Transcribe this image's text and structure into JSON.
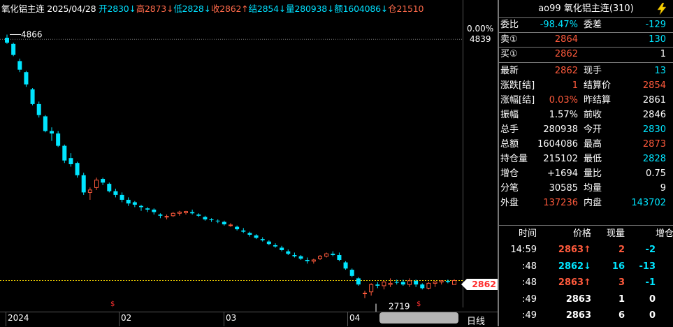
{
  "header": {
    "name": "氧化铝主连",
    "date": "2025/04/28",
    "open_label": "开",
    "open": "2830",
    "high_label": "高",
    "high": "2873",
    "low_label": "低",
    "low": "2828",
    "close_label": "收",
    "close": "2862",
    "settle_label": "结",
    "settle": "2854",
    "vol_label": "量",
    "vol": "280938",
    "amt_label": "额",
    "amt": "1604086",
    "oi_label": "仓",
    "oi": "21510"
  },
  "price_axis": {
    "pct": "0.00%",
    "top_price": "4839",
    "high_marker": "4866",
    "low_marker": "2719",
    "last_price_tag": "2862"
  },
  "x_axis": {
    "labels": [
      "2024",
      "02",
      "03",
      "04"
    ],
    "period_label": "日线"
  },
  "colors": {
    "up": "#ff5a3c",
    "down": "#00e5ff",
    "yellow": "#f0d000",
    "background": "#000000"
  },
  "panel": {
    "title": "ao99 氧化铝主连(310)",
    "bolt_icon": "lightning-bolt-icon",
    "weibi_label": "委比",
    "weibi": "-98.47%",
    "weicha_label": "委差",
    "weicha": "-129",
    "sell1_label": "卖①",
    "sell1_price": "2864",
    "sell1_vol": "130",
    "buy1_label": "买①",
    "buy1_price": "2862",
    "buy1_vol": "1",
    "stats": [
      {
        "l1": "最新",
        "v1": "2862",
        "c1": "#ff5a3c",
        "l2": "现手",
        "v2": "13",
        "c2": "#00e5ff"
      },
      {
        "l1": "涨跌[结]",
        "v1": "1",
        "c1": "#ff5a3c",
        "l2": "结算价",
        "v2": "2854",
        "c2": "#ff5a3c"
      },
      {
        "l1": "涨幅[结]",
        "v1": "0.03%",
        "c1": "#ff5a3c",
        "l2": "昨结算",
        "v2": "2861",
        "c2": "#ffffff"
      },
      {
        "l1": "振幅",
        "v1": "1.57%",
        "c1": "#ffffff",
        "l2": "前收",
        "v2": "2846",
        "c2": "#ffffff"
      },
      {
        "l1": "总手",
        "v1": "280938",
        "c1": "#ffffff",
        "l2": "今开",
        "v2": "2830",
        "c2": "#00e5ff"
      },
      {
        "l1": "总额",
        "v1": "1604086",
        "c1": "#ffffff",
        "l2": "最高",
        "v2": "2873",
        "c2": "#ff5a3c"
      },
      {
        "l1": "持仓量",
        "v1": "215102",
        "c1": "#ffffff",
        "l2": "最低",
        "v2": "2828",
        "c2": "#00e5ff"
      },
      {
        "l1": "增仓",
        "v1": "+1694",
        "c1": "#ffffff",
        "l2": "量比",
        "v2": "0.75",
        "c2": "#ffffff"
      },
      {
        "l1": "分笔",
        "v1": "30585",
        "c1": "#ffffff",
        "l2": "均量",
        "v2": "9",
        "c2": "#ffffff"
      },
      {
        "l1": "外盘",
        "v1": "137236",
        "c1": "#ff5a3c",
        "l2": "内盘",
        "v2": "143702",
        "c2": "#00e5ff"
      }
    ],
    "ticks_header": {
      "time": "时间",
      "price": "价格",
      "vol": "现量",
      "oi": "增仓"
    },
    "ticks": [
      {
        "time": "14:59",
        "price": "2863",
        "arrow": "↑",
        "pcolor": "#ff5a3c",
        "vol": "2",
        "vcolor": "#ff5a3c",
        "oi": "-2",
        "ocolor": "#00e5ff"
      },
      {
        "time": ":48",
        "price": "2862",
        "arrow": "↓",
        "pcolor": "#00e5ff",
        "vol": "16",
        "vcolor": "#00e5ff",
        "oi": "-13",
        "ocolor": "#00e5ff"
      },
      {
        "time": ":48",
        "price": "2863",
        "arrow": "↑",
        "pcolor": "#ff5a3c",
        "vol": "3",
        "vcolor": "#ff5a3c",
        "oi": "-1",
        "ocolor": "#00e5ff"
      },
      {
        "time": ":49",
        "price": "2863",
        "arrow": "",
        "pcolor": "#ffffff",
        "vol": "1",
        "vcolor": "#ffffff",
        "oi": "0",
        "ocolor": "#ffffff"
      },
      {
        "time": ":49",
        "price": "2863",
        "arrow": "",
        "pcolor": "#ffffff",
        "vol": "6",
        "vcolor": "#ffffff",
        "oi": "0",
        "ocolor": "#ffffff"
      }
    ]
  },
  "chart_data": {
    "type": "candlestick",
    "title": "",
    "ylim": [
      2700,
      4880
    ],
    "candles": [
      [
        4840,
        4866,
        4790,
        4800
      ],
      [
        4790,
        4800,
        4690,
        4700
      ],
      [
        4650,
        4670,
        4560,
        4580
      ],
      [
        4560,
        4570,
        4440,
        4460
      ],
      [
        4420,
        4430,
        4290,
        4300
      ],
      [
        4300,
        4320,
        4190,
        4210
      ],
      [
        4200,
        4210,
        4070,
        4080
      ],
      [
        4080,
        4110,
        4000,
        4060
      ],
      [
        4060,
        4080,
        3950,
        3960
      ],
      [
        3960,
        3970,
        3820,
        3840
      ],
      [
        3860,
        3900,
        3790,
        3810
      ],
      [
        3820,
        3830,
        3700,
        3720
      ],
      [
        3720,
        3740,
        3560,
        3580
      ],
      [
        3580,
        3620,
        3520,
        3600
      ],
      [
        3620,
        3700,
        3600,
        3680
      ],
      [
        3690,
        3700,
        3640,
        3660
      ],
      [
        3650,
        3660,
        3580,
        3590
      ],
      [
        3590,
        3610,
        3540,
        3560
      ],
      [
        3560,
        3580,
        3500,
        3520
      ],
      [
        3520,
        3540,
        3470,
        3490
      ],
      [
        3500,
        3510,
        3460,
        3480
      ],
      [
        3470,
        3480,
        3430,
        3460
      ],
      [
        3450,
        3460,
        3420,
        3440
      ],
      [
        3440,
        3450,
        3400,
        3420
      ],
      [
        3400,
        3410,
        3370,
        3390
      ],
      [
        3380,
        3400,
        3360,
        3385
      ],
      [
        3390,
        3420,
        3380,
        3410
      ],
      [
        3410,
        3430,
        3390,
        3420
      ],
      [
        3415,
        3430,
        3400,
        3425
      ],
      [
        3420,
        3440,
        3400,
        3410
      ],
      [
        3400,
        3410,
        3380,
        3390
      ],
      [
        3380,
        3390,
        3350,
        3360
      ],
      [
        3360,
        3370,
        3340,
        3355
      ],
      [
        3350,
        3360,
        3330,
        3345
      ],
      [
        3340,
        3350,
        3310,
        3320
      ],
      [
        3310,
        3330,
        3300,
        3315
      ],
      [
        3300,
        3310,
        3270,
        3280
      ],
      [
        3270,
        3290,
        3250,
        3260
      ],
      [
        3250,
        3260,
        3220,
        3235
      ],
      [
        3230,
        3240,
        3200,
        3210
      ],
      [
        3200,
        3215,
        3180,
        3190
      ],
      [
        3180,
        3190,
        3150,
        3160
      ],
      [
        3150,
        3165,
        3130,
        3140
      ],
      [
        3130,
        3145,
        3100,
        3110
      ],
      [
        3100,
        3115,
        3070,
        3080
      ],
      [
        3070,
        3090,
        3050,
        3060
      ],
      [
        3060,
        3070,
        3030,
        3040
      ],
      [
        3030,
        3050,
        3000,
        3020
      ],
      [
        3020,
        3040,
        3000,
        3030
      ],
      [
        3040,
        3070,
        3030,
        3060
      ],
      [
        3060,
        3090,
        3050,
        3080
      ],
      [
        3080,
        3100,
        3060,
        3070
      ],
      [
        3070,
        3090,
        3020,
        3030
      ],
      [
        3010,
        3020,
        2950,
        2960
      ],
      [
        2950,
        2960,
        2890,
        2900
      ],
      [
        2880,
        2890,
        2820,
        2830
      ],
      [
        2760,
        2780,
        2719,
        2760
      ],
      [
        2770,
        2840,
        2740,
        2830
      ],
      [
        2830,
        2850,
        2800,
        2820
      ],
      [
        2820,
        2860,
        2790,
        2850
      ],
      [
        2830,
        2880,
        2810,
        2840
      ],
      [
        2850,
        2870,
        2830,
        2845
      ],
      [
        2850,
        2870,
        2820,
        2830
      ],
      [
        2830,
        2880,
        2810,
        2860
      ],
      [
        2860,
        2870,
        2810,
        2830
      ],
      [
        2830,
        2840,
        2790,
        2800
      ],
      [
        2800,
        2850,
        2790,
        2840
      ],
      [
        2840,
        2860,
        2810,
        2850
      ],
      [
        2850,
        2865,
        2830,
        2860
      ],
      [
        2860,
        2870,
        2840,
        2850
      ],
      [
        2830,
        2873,
        2828,
        2862
      ]
    ]
  }
}
